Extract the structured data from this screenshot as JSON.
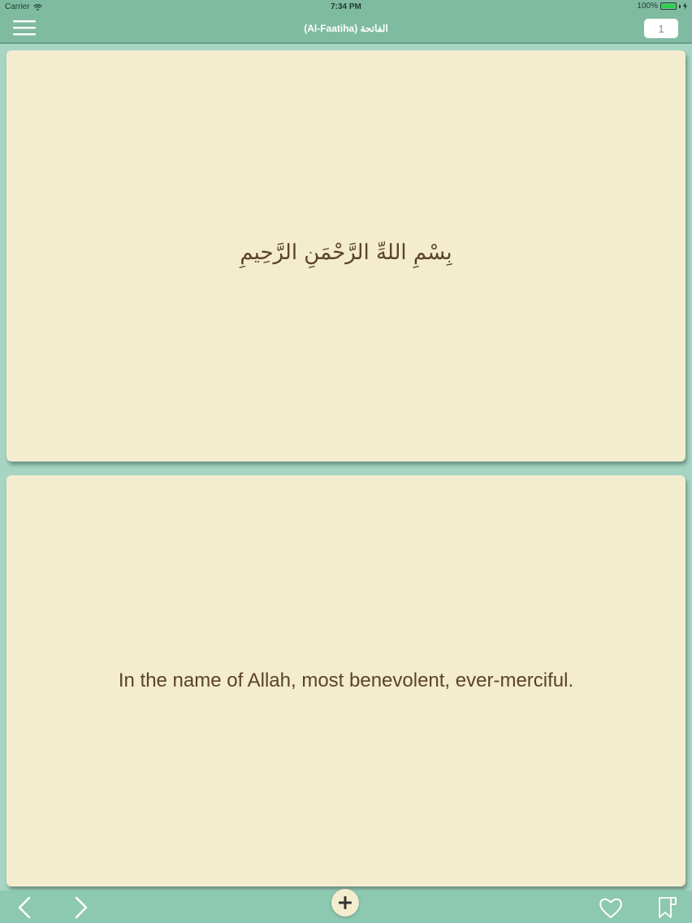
{
  "status_bar": {
    "carrier": "Carrier",
    "time": "7:34 PM",
    "battery": "100%",
    "battery_level": 1.0
  },
  "nav": {
    "title": "(Al-Faatiha) الفاتحة",
    "verse_number": "1"
  },
  "verse": {
    "arabic": "بِسْمِ اللهِّ الرَّحْمَنِ الرَّحِيمِ",
    "translation": "In the name of Allah, most benevolent, ever-merciful."
  },
  "icons": {
    "menu": "hamburger-menu-icon",
    "prev": "chevron-left-icon",
    "next": "chevron-right-icon",
    "add": "plus-icon",
    "favorite": "heart-icon",
    "bookmark": "bookmark-icon"
  },
  "colors": {
    "header": "#7fbba0",
    "background": "#a6d6c3",
    "card": "#f3eccf",
    "text": "#5c4325",
    "icon": "#ffffff"
  }
}
